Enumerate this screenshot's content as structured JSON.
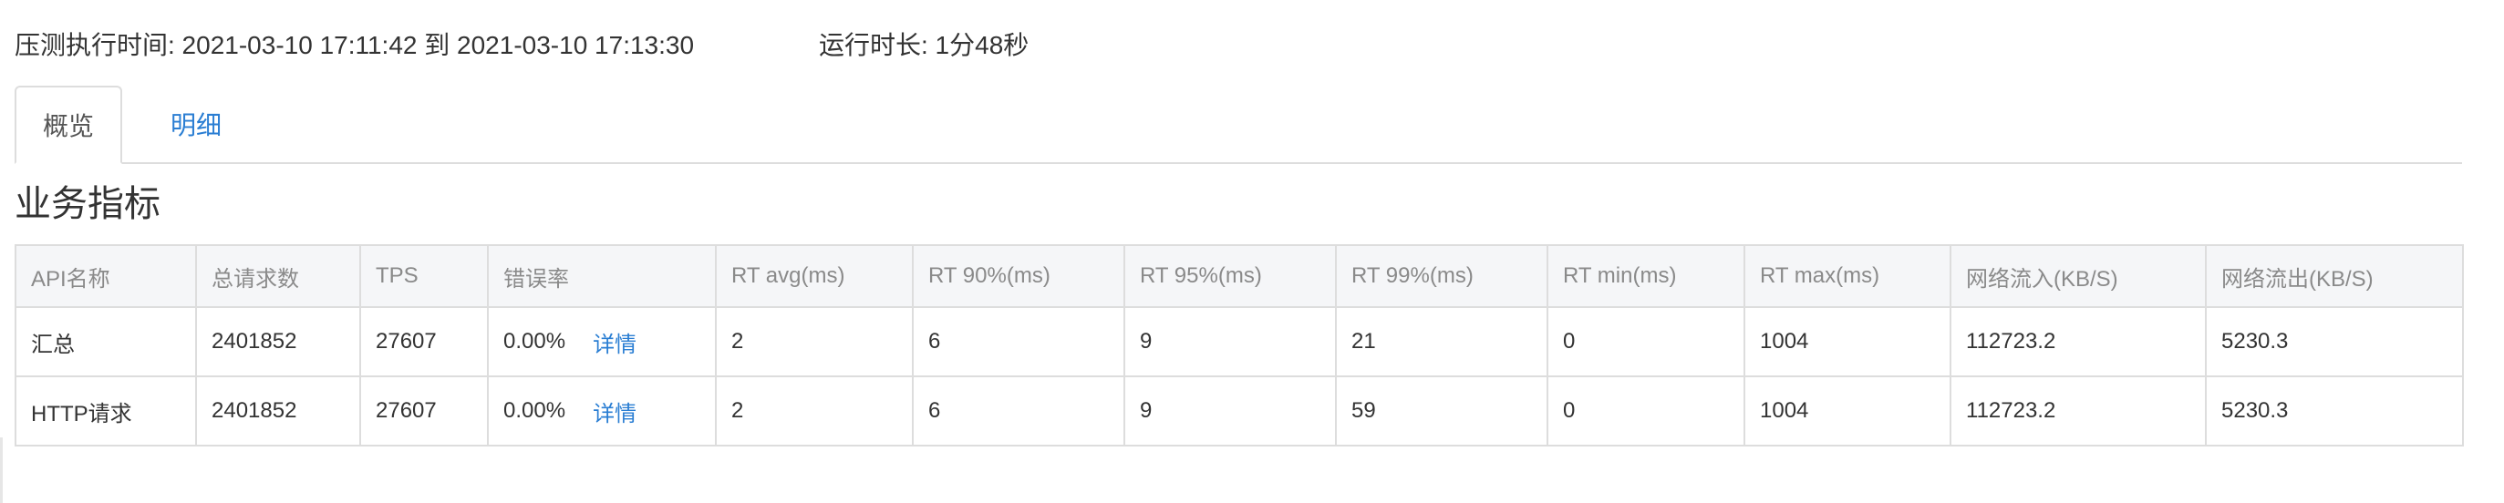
{
  "header": {
    "time_range": "压测执行时间: 2021-03-10 17:11:42 到 2021-03-10 17:13:30",
    "duration": "运行时长: 1分48秒"
  },
  "tabs": [
    {
      "label": "概览",
      "active": true
    },
    {
      "label": "明细",
      "active": false
    }
  ],
  "section": {
    "title": "业务指标"
  },
  "table": {
    "columns": [
      "API名称",
      "总请求数",
      "TPS",
      "错误率",
      "RT avg(ms)",
      "RT 90%(ms)",
      "RT 95%(ms)",
      "RT 99%(ms)",
      "RT min(ms)",
      "RT max(ms)",
      "网络流入(KB/S)",
      "网络流出(KB/S)"
    ],
    "detail_label": "详情",
    "rows": [
      {
        "api": "汇总",
        "total": "2401852",
        "tps": "27607",
        "error_rate": "0.00%",
        "rt_avg": "2",
        "rt_90": "6",
        "rt_95": "9",
        "rt_99": "21",
        "rt_min": "0",
        "rt_max": "1004",
        "net_in": "112723.2",
        "net_out": "5230.3"
      },
      {
        "api": "HTTP请求",
        "total": "2401852",
        "tps": "27607",
        "error_rate": "0.00%",
        "rt_avg": "2",
        "rt_90": "6",
        "rt_95": "9",
        "rt_99": "59",
        "rt_min": "0",
        "rt_max": "1004",
        "net_in": "112723.2",
        "net_out": "5230.3"
      }
    ]
  },
  "colors": {
    "link": "#2a7ed3",
    "border": "#dddddd",
    "header_bg": "#f5f6f8",
    "header_text": "#8a8a8a",
    "text": "#333333"
  }
}
